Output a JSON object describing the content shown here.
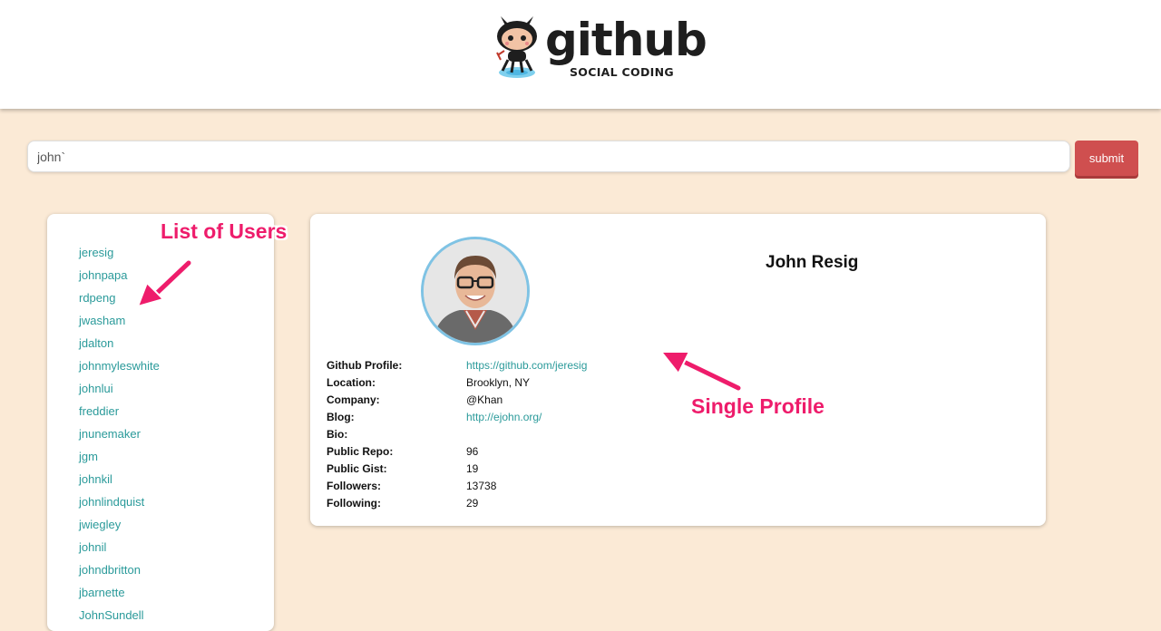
{
  "header": {
    "logo_word": "github",
    "logo_tagline": "SOCIAL CODING"
  },
  "search": {
    "value": "john`",
    "submit_label": "submit"
  },
  "users": [
    "jeresig",
    "johnpapa",
    "rdpeng",
    "jwasham",
    "jdalton",
    "johnmyleswhite",
    "johnlui",
    "freddier",
    "jnunemaker",
    "jgm",
    "johnkil",
    "johnlindquist",
    "jwiegley",
    "johnil",
    "johndbritton",
    "jbarnette",
    "JohnSundell"
  ],
  "profile": {
    "name": "John Resig",
    "fields": [
      {
        "label": "Github Profile:",
        "value": "https://github.com/jeresig",
        "link": true
      },
      {
        "label": "Location:",
        "value": "Brooklyn, NY",
        "link": false
      },
      {
        "label": "Company:",
        "value": "@Khan",
        "link": false
      },
      {
        "label": "Blog:",
        "value": "http://ejohn.org/",
        "link": true
      },
      {
        "label": "Bio:",
        "value": "",
        "link": false
      },
      {
        "label": "Public Repo:",
        "value": "96",
        "link": false
      },
      {
        "label": "Public Gist:",
        "value": "19",
        "link": false
      },
      {
        "label": "Followers:",
        "value": "13738",
        "link": false
      },
      {
        "label": "Following:",
        "value": "29",
        "link": false
      }
    ]
  },
  "annotations": {
    "list_label": "List of Users",
    "profile_label": "Single Profile"
  },
  "colors": {
    "page_bg": "#fbead6",
    "link": "#2a9a9a",
    "submit": "#cf4f4f",
    "annotation": "#ee1c6b",
    "avatar_ring": "#7fc3e4"
  }
}
